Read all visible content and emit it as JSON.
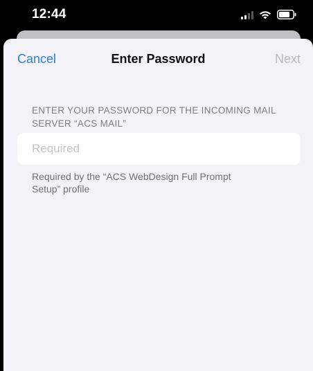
{
  "status_bar": {
    "time": "12:44",
    "signal_icon": "cellular-signal-icon",
    "wifi_icon": "wifi-icon",
    "battery_icon": "battery-icon"
  },
  "nav": {
    "cancel_label": "Cancel",
    "title": "Enter Password",
    "next_label": "Next"
  },
  "form": {
    "header": "ENTER YOUR PASSWORD FOR THE INCOMING MAIL SERVER “ACS MAIL”",
    "password_placeholder": "Required",
    "password_value": "",
    "footer": "Required by the “ACS WebDesign Full Prompt Setup” profile"
  },
  "colors": {
    "accent": "#2f7ed8",
    "disabled": "#b9b9be",
    "sheet_background": "#f2f2f7"
  }
}
